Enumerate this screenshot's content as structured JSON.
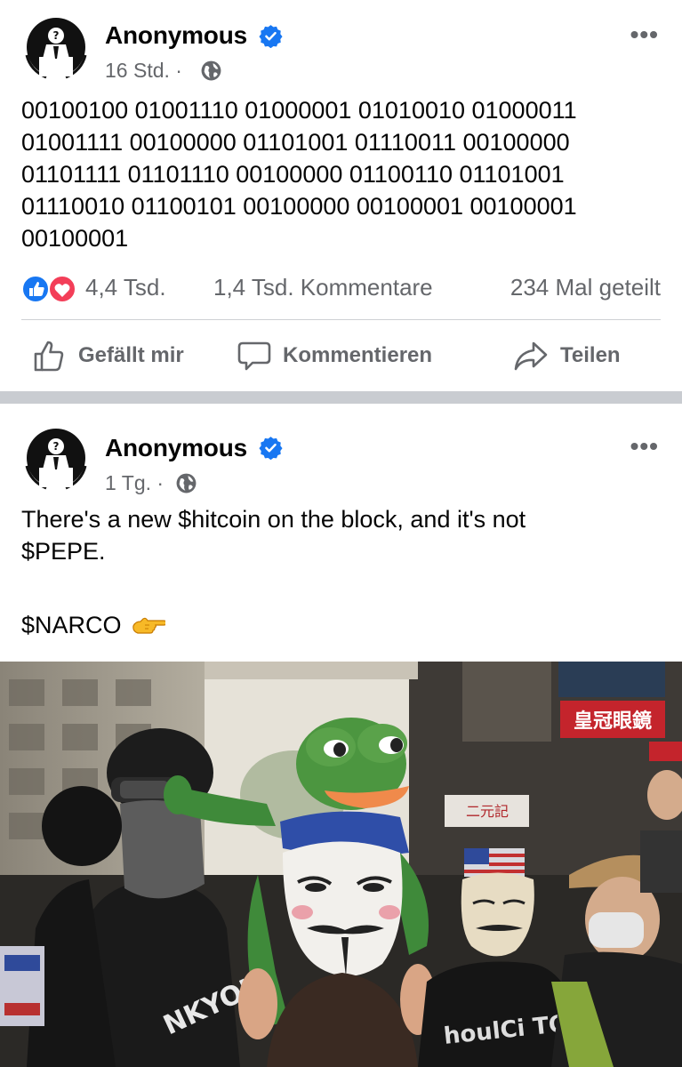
{
  "post1": {
    "author": "Anonymous",
    "time": "16 Std. ·",
    "text": "00100100 01001110 01000001 01010010 01000011 01001111 00100000 01101001 01110011 00100000 01101111 01101110 00100000 01100110 01101001 01110010 01100101 00100000 00100001 00100001 00100001",
    "reactions_count": "4,4 Tsd.",
    "comments_count": "1,4 Tsd. Kommentare",
    "shares_count": "234 Mal geteilt",
    "actions": {
      "like": "Gefällt mir",
      "comment": "Kommentieren",
      "share": "Teilen"
    }
  },
  "post2": {
    "author": "Anonymous",
    "time": "1 Tg. ·",
    "text_line1": "There's a new $hitcoin on the block, and it's not",
    "text_line2": "$PEPE.",
    "text_line3": "$NARCO",
    "emoji": "👈",
    "photo": {
      "sign_top": "皇冠眼鏡",
      "sign_mid": "二元記"
    }
  },
  "colors": {
    "verified": "#1877f2",
    "like_blue": "#1877f2",
    "love_red": "#f33e58",
    "secondary_text": "#65676b",
    "separator": "#c9ccd1"
  },
  "icons": [
    "anonymous-logo-icon",
    "verified-badge-icon",
    "globe-icon",
    "more-options-icon",
    "like-reaction-icon",
    "love-reaction-icon",
    "thumbs-up-icon",
    "comment-bubble-icon",
    "share-arrow-icon"
  ]
}
